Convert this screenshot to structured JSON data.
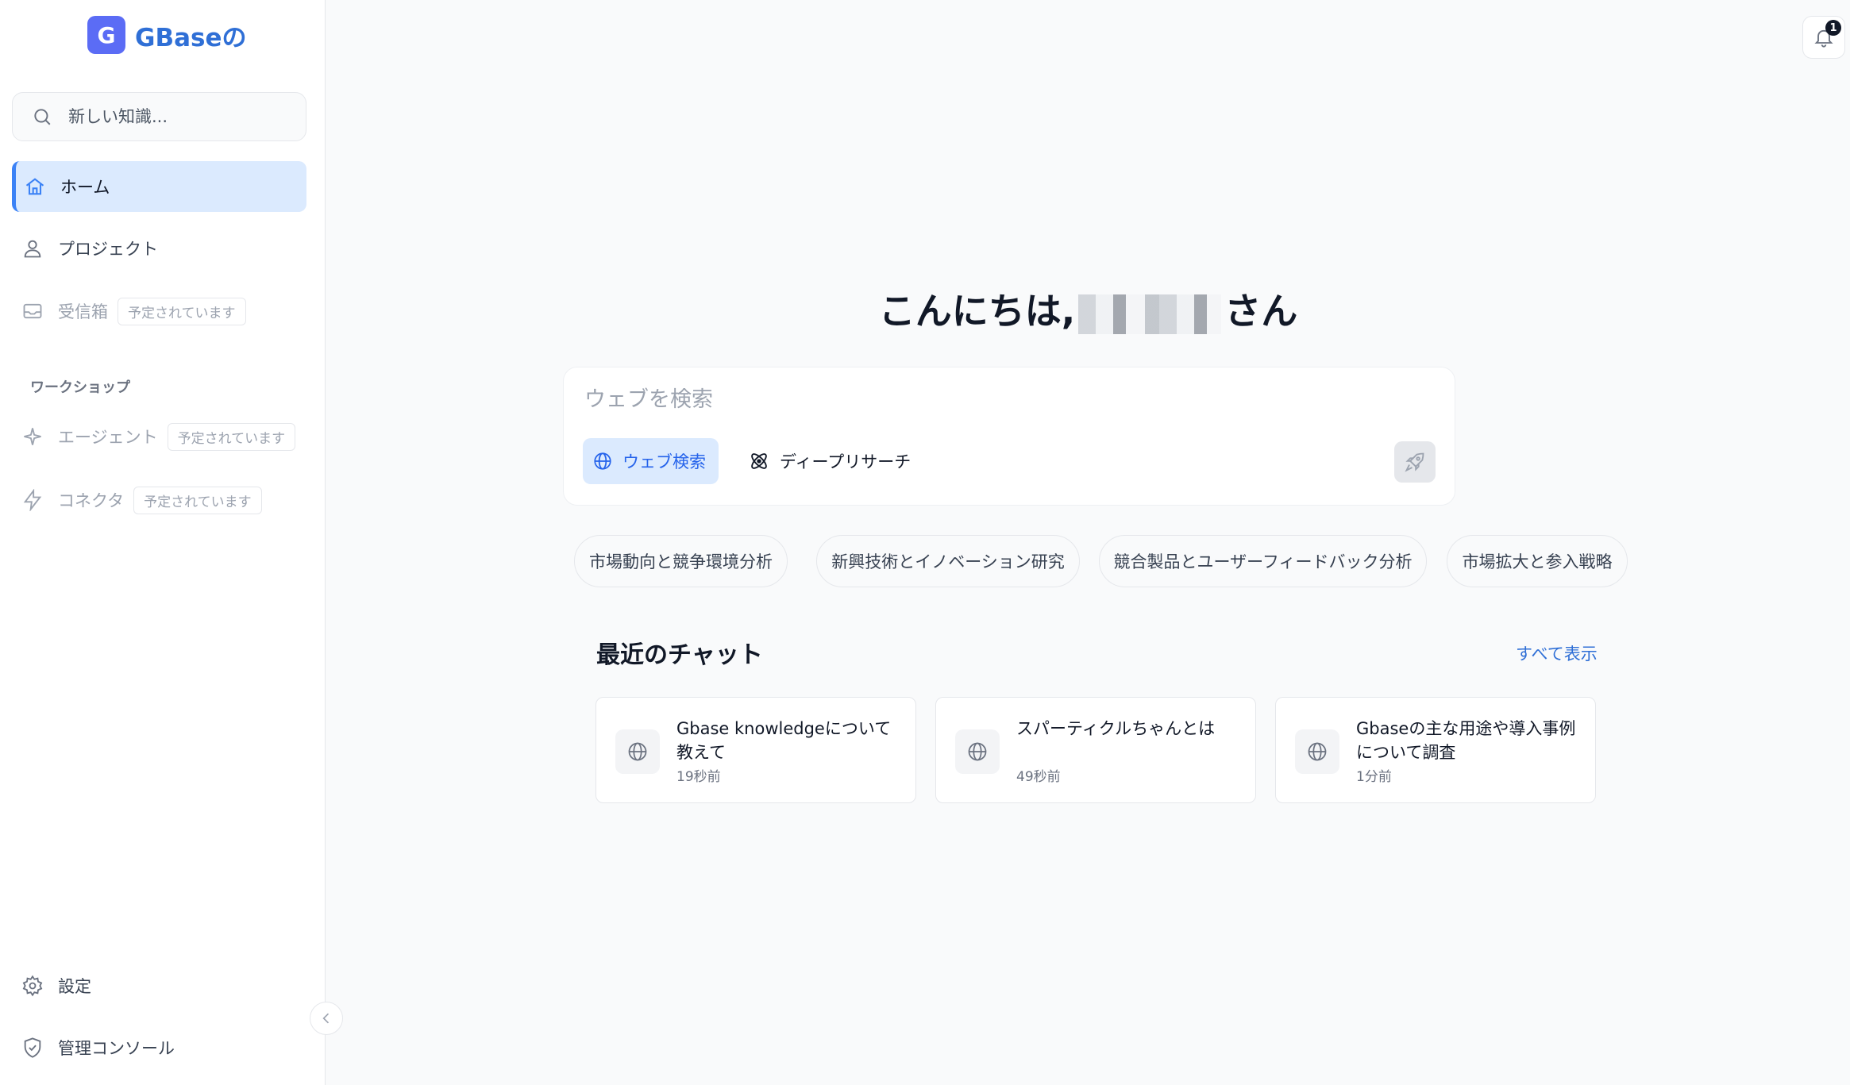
{
  "app": {
    "logo_letter": "G",
    "logo_text": "GBaseの"
  },
  "sidebar": {
    "search_placeholder": "新しい知識...",
    "items": [
      {
        "label": "ホーム",
        "icon": "home-icon",
        "active": true
      },
      {
        "label": "プロジェクト",
        "icon": "user-icon"
      },
      {
        "label": "受信箱",
        "icon": "inbox-icon",
        "badge": "予定されています"
      }
    ],
    "section_label": "ワークショップ",
    "workshop_items": [
      {
        "label": "エージェント",
        "icon": "sparkle-icon",
        "badge": "予定されています"
      },
      {
        "label": "コネクタ",
        "icon": "lightning-icon",
        "badge": "予定されています"
      }
    ],
    "bottom_items": [
      {
        "label": "設定",
        "icon": "gear-icon"
      },
      {
        "label": "管理コンソール",
        "icon": "shield-icon"
      }
    ]
  },
  "header": {
    "notification_count": "1"
  },
  "main": {
    "greeting_prefix": "こんにちは,",
    "greeting_suffix": "さん",
    "prompt_placeholder": "ウェブを検索",
    "modes": [
      {
        "label": "ウェブ検索",
        "icon": "globe-icon",
        "active": true
      },
      {
        "label": "ディープリサーチ",
        "icon": "atom-icon"
      }
    ],
    "suggestions": [
      "市場動向と競争環境分析",
      "新興技術とイノベーション研究",
      "競合製品とユーザーフィードバック分析",
      "市場拡大と参入戦略"
    ],
    "recent_title": "最近のチャット",
    "show_all": "すべて表示",
    "chats": [
      {
        "title": "Gbase knowledgeについて教えて",
        "time": "19秒前"
      },
      {
        "title": "スパーティクルちゃんとは",
        "time": "49秒前"
      },
      {
        "title": "Gbaseの主な用途や導入事例について調査",
        "time": "1分前"
      }
    ]
  },
  "colors": {
    "accent": "#2f6fd6",
    "logo_bg": "#5b6cf5",
    "active_bg": "#dbeafe"
  }
}
